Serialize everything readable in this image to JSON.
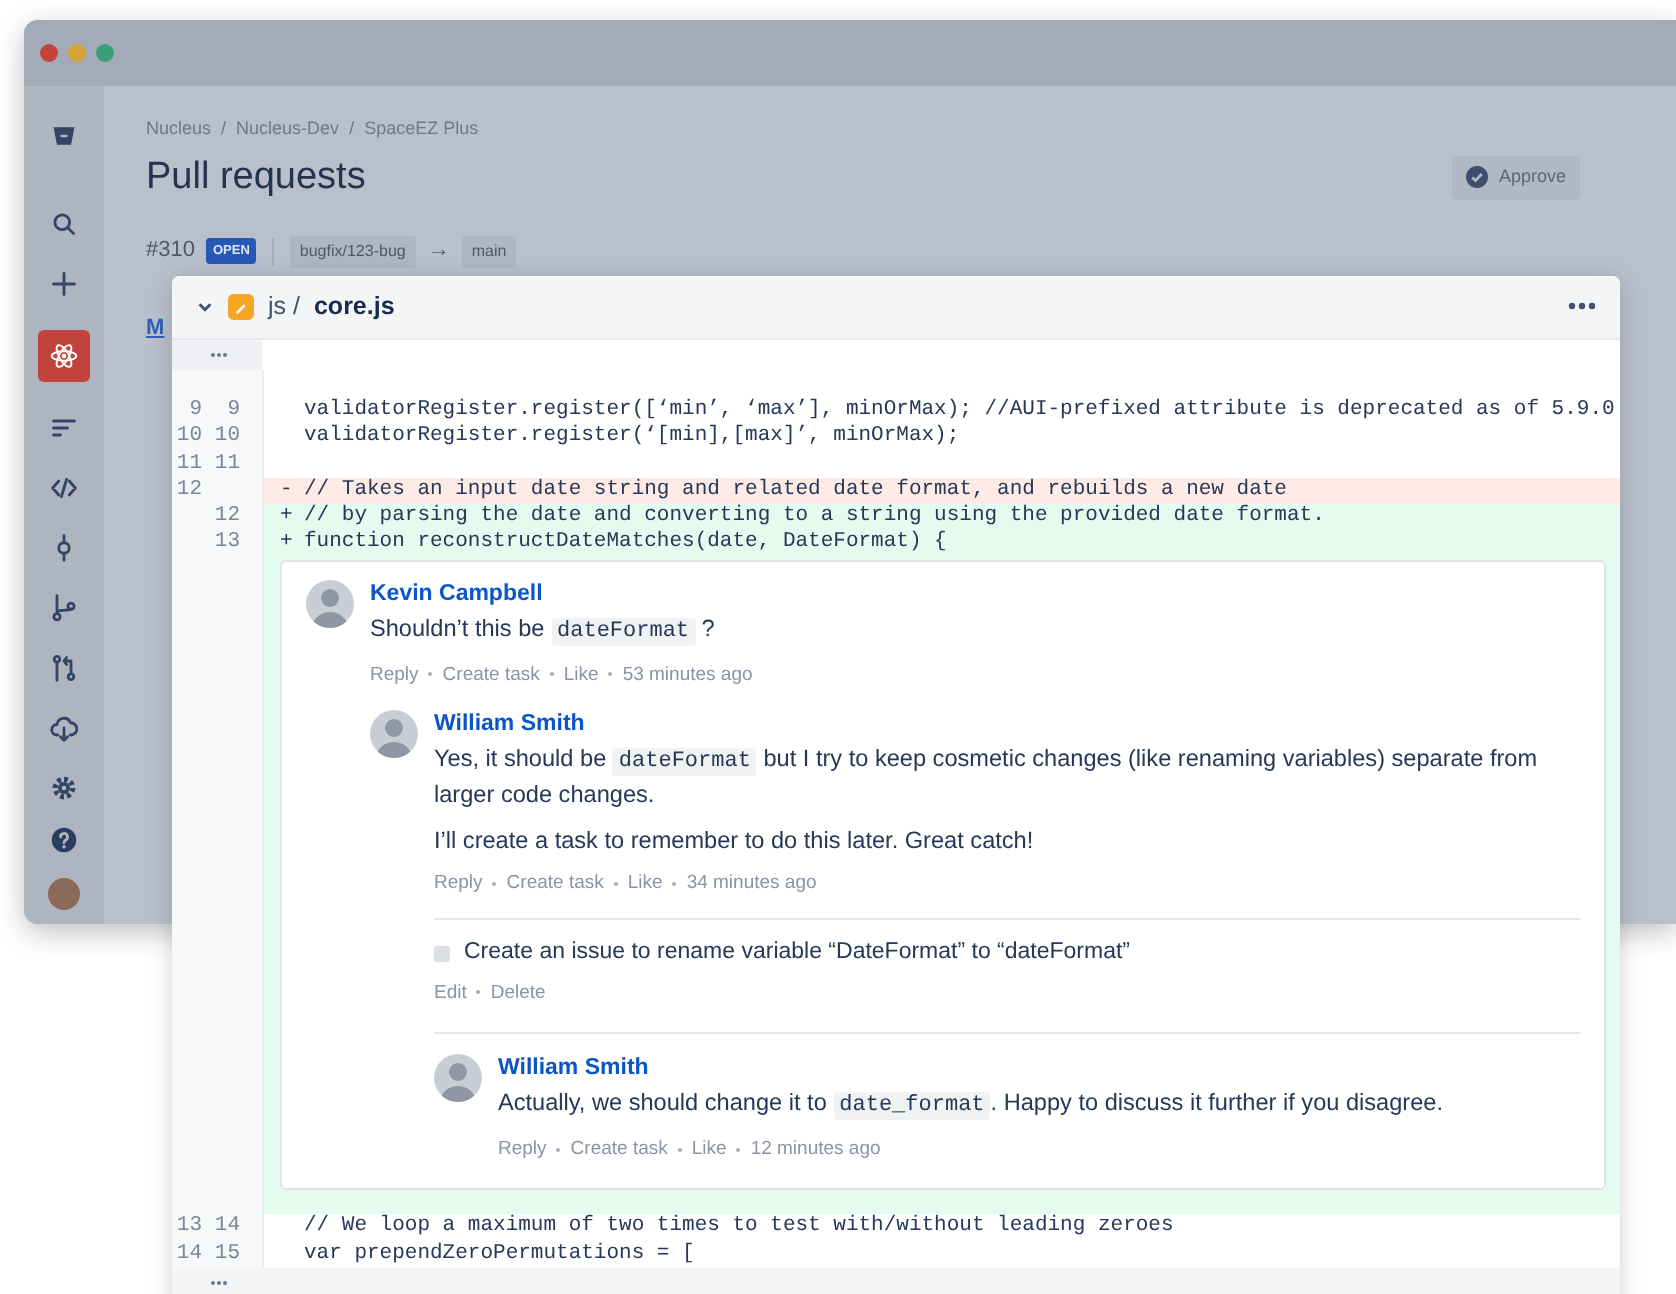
{
  "window": {
    "controls": [
      {
        "color": "#c4443c"
      },
      {
        "color": "#d4a235"
      },
      {
        "color": "#3a9f78"
      }
    ]
  },
  "sidebar": {
    "items": [
      {
        "selected": false
      },
      {
        "selected": false
      },
      {
        "selected": false
      },
      {
        "selected": true
      },
      {
        "selected": false
      },
      {
        "selected": false
      },
      {
        "selected": false
      },
      {
        "selected": false
      },
      {
        "selected": false
      },
      {
        "selected": false
      },
      {
        "selected": false
      }
    ]
  },
  "breadcrumbs": [
    "Nucleus",
    "/",
    "Nucleus-Dev",
    "/",
    "SpaceEZ Plus"
  ],
  "title": "Pull requests",
  "approve_button": {
    "label": "Approve"
  },
  "pull_request": {
    "number": "#310",
    "status": "OPEN",
    "source_branch": "bugfix/123-bug",
    "arrow": "→",
    "target_branch": "main"
  },
  "partial_link": "M",
  "file_panel": {
    "expanded": true,
    "folder": "js /",
    "filename": "core.js",
    "rows": [
      {
        "kind": "hunk"
      },
      {
        "kind": "context",
        "old": "9",
        "new": "9",
        "text": "validatorRegister.register([‘min’, ‘max’], minOrMax); //AUI-prefixed attribute is deprecated as of 5.9.0"
      },
      {
        "kind": "context",
        "old": "10",
        "new": "10",
        "text": "validatorRegister.register(‘[min],[max]’, minOrMax);"
      },
      {
        "kind": "context",
        "old": "11",
        "new": "11",
        "text": ""
      },
      {
        "kind": "removed",
        "old": "12",
        "sign": "-",
        "text": "// Takes an input date string and related date format, and rebuilds a new date"
      },
      {
        "kind": "added",
        "new": "12",
        "sign": "+",
        "text": "// by parsing the date and converting to a string using the provided date format."
      },
      {
        "kind": "added",
        "new": "13",
        "sign": "+",
        "text": "function reconstructDateMatches(date, DateFormat) {"
      },
      {
        "kind": "comments",
        "threads": [
          {
            "kind": "comment",
            "author": "Kevin Campbell",
            "paragraphs": [
              [
                {
                  "text": "Shouldn’t this be "
                },
                {
                  "code": "dateFormat"
                },
                {
                  "text": " ?"
                }
              ]
            ],
            "actions": [
              "Reply",
              "Create task",
              "Like",
              "53 minutes ago"
            ],
            "children": [
              {
                "kind": "comment",
                "author": "William Smith",
                "paragraphs": [
                  [
                    {
                      "text": "Yes, it should be "
                    },
                    {
                      "code": "dateFormat"
                    },
                    {
                      "text": " but I try to keep cosmetic changes (like renaming variables) separate from larger code changes."
                    }
                  ],
                  [
                    {
                      "text": "I’ll create a task to remember to do this later. Great catch!"
                    }
                  ]
                ],
                "actions": [
                  "Reply",
                  "Create task",
                  "Like",
                  "34 minutes ago"
                ],
                "children": [
                  {
                    "kind": "task",
                    "checked": false,
                    "text": "Create an issue to rename variable “DateFormat” to “dateFormat”",
                    "actions": [
                      "Edit",
                      "Delete"
                    ]
                  },
                  {
                    "kind": "comment",
                    "author": "William Smith",
                    "paragraphs": [
                      [
                        {
                          "text": "Actually, we should change it to "
                        },
                        {
                          "code": "date_format"
                        },
                        {
                          "text": ". Happy to discuss it further if you disagree."
                        }
                      ]
                    ],
                    "actions": [
                      "Reply",
                      "Create task",
                      "Like",
                      "12 minutes ago"
                    ]
                  }
                ]
              }
            ]
          }
        ]
      },
      {
        "kind": "context",
        "old": "13",
        "new": "14",
        "text": "// We loop a maximum of two times to test with/without leading zeroes"
      },
      {
        "kind": "context",
        "old": "14",
        "new": "15",
        "text": "var prependZeroPermutations = ["
      },
      {
        "kind": "hunk"
      }
    ]
  }
}
